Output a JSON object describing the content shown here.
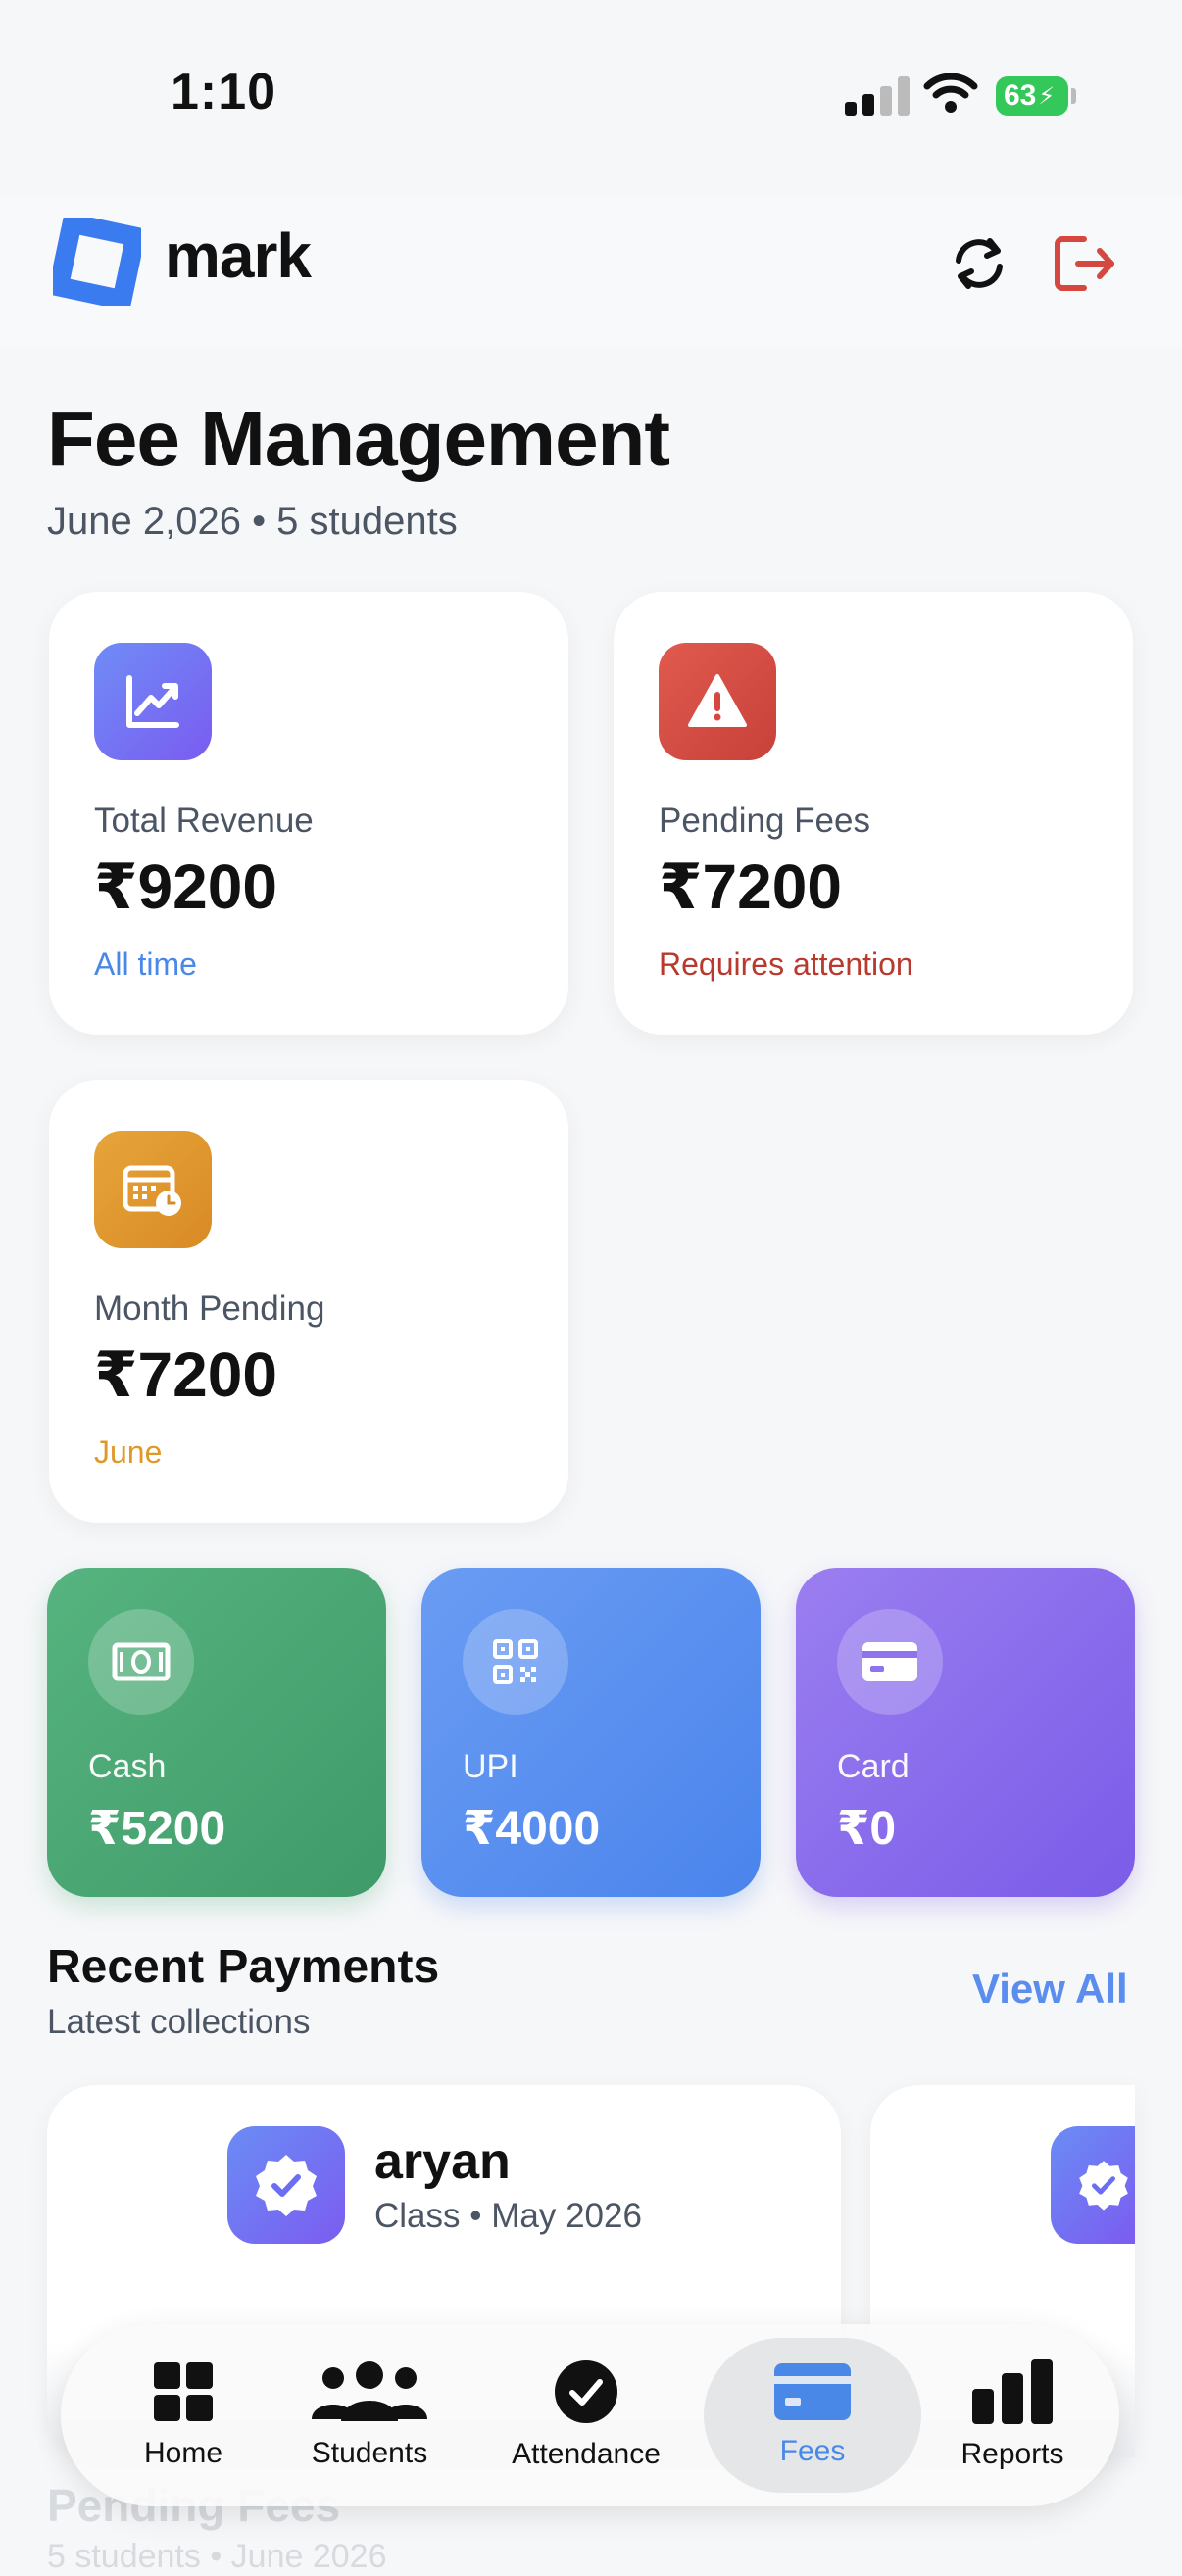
{
  "status_bar": {
    "time": "1:10",
    "battery": "63"
  },
  "brand": {
    "name": "mark"
  },
  "page": {
    "title": "Fee Management",
    "subtitle": "June 2,026 • 5 students"
  },
  "stats": [
    {
      "label": "Total Revenue",
      "value": "₹9200",
      "note": "All time",
      "note_color": "#4a88e8",
      "icon": "trending-up-icon"
    },
    {
      "label": "Pending Fees",
      "value": "₹7200",
      "note": "Requires attention",
      "note_color": "#b83a2e",
      "icon": "warning-icon"
    },
    {
      "label": "Month Pending",
      "value": "₹7200",
      "note": "June",
      "note_color": "#dd9a2b",
      "icon": "calendar-clock-icon"
    }
  ],
  "payment_methods": [
    {
      "label": "Cash",
      "value": "₹5200",
      "icon": "banknote-icon"
    },
    {
      "label": "UPI",
      "value": "₹4000",
      "icon": "qr-code-icon"
    },
    {
      "label": "Card",
      "value": "₹0",
      "icon": "credit-card-icon"
    }
  ],
  "recent_payments": {
    "title": "Recent Payments",
    "subtitle": "Latest collections",
    "view_all": "View All",
    "items": [
      {
        "name": "aryan",
        "meta": "Class  • May 2026"
      }
    ]
  },
  "below": {
    "title": "Pending Fees",
    "subtitle": "5 students • June 2026"
  },
  "tabs": [
    {
      "label": "Home",
      "icon": "grid-icon",
      "active": false
    },
    {
      "label": "Students",
      "icon": "people-icon",
      "active": false
    },
    {
      "label": "Attendance",
      "icon": "check-circle-icon",
      "active": false
    },
    {
      "label": "Fees",
      "icon": "credit-card-icon",
      "active": true
    },
    {
      "label": "Reports",
      "icon": "bar-chart-icon",
      "active": false
    }
  ],
  "colors": {
    "accent": "#4a88e8",
    "danger": "#d5483f",
    "warning": "#e0992c",
    "cash": "#4aa873",
    "upi": "#5b8def",
    "card": "#8a6cf0"
  }
}
